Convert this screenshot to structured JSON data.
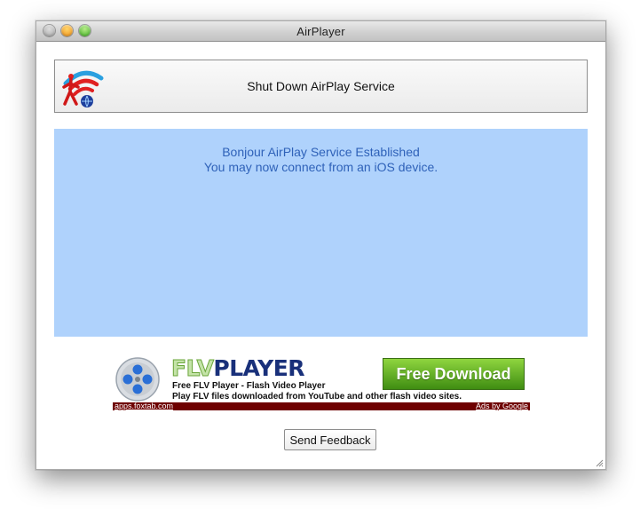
{
  "window": {
    "title": "AirPlayer"
  },
  "service_button": {
    "label": "Shut Down AirPlay Service",
    "icon": "airplay-broadcast-icon"
  },
  "status_panel": {
    "line1": "Bonjour AirPlay Service Established",
    "line2": "You may now connect from an iOS device.",
    "background": "#afd2fc",
    "text_color": "#2f62b9"
  },
  "ad": {
    "brand_part1": "FLV",
    "brand_part2": "PLAYER",
    "title": "Free FLV Player - Flash Video Player",
    "description": "Play FLV files downloaded from YouTube and other flash video sites.",
    "cta_label": "Free Download",
    "source_link": "apps.foxtab.com",
    "attribution_link": "Ads by Google",
    "cta_color": "#5fae22",
    "footer_color": "#6e0000"
  },
  "feedback_button": {
    "label": "Send Feedback"
  }
}
